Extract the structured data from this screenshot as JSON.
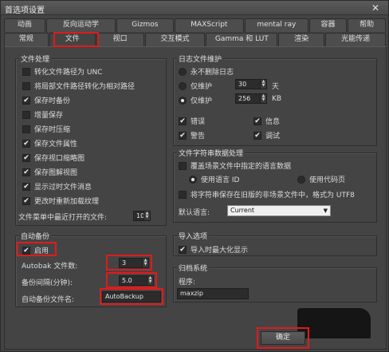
{
  "window": {
    "title": "首选项设置",
    "close_label": "✕"
  },
  "tabs_row1": [
    {
      "label": "动画"
    },
    {
      "label": "反向运动学"
    },
    {
      "label": "Gizmos"
    },
    {
      "label": "MAXScript"
    },
    {
      "label": "mental ray"
    },
    {
      "label": "容器"
    },
    {
      "label": "帮助"
    }
  ],
  "tabs_row2": [
    {
      "label": "常规"
    },
    {
      "label": "文件"
    },
    {
      "label": "视口"
    },
    {
      "label": "交互模式"
    },
    {
      "label": "Gamma 和 LUT"
    },
    {
      "label": "渲染"
    },
    {
      "label": "光能传递"
    }
  ],
  "file_handling": {
    "title": "文件处理",
    "options": [
      {
        "label": "转化文件路径为 UNC",
        "checked": false
      },
      {
        "label": "将局部文件路径转化为相对路径",
        "checked": false
      },
      {
        "label": "保存时备份",
        "checked": true
      },
      {
        "label": "增量保存",
        "checked": false
      },
      {
        "label": "保存时压缩",
        "checked": false
      },
      {
        "label": "保存文件属性",
        "checked": true
      },
      {
        "label": "保存视口缩略图",
        "checked": true
      },
      {
        "label": "保存图解视图",
        "checked": true
      },
      {
        "label": "显示过时文件消息",
        "checked": true
      },
      {
        "label": "更改时重新加载纹理",
        "checked": true
      }
    ],
    "recent_label": "文件菜单中最近打开的文件:",
    "recent_value": "10"
  },
  "log": {
    "title": "日志文件维护",
    "never_delete": "永不删除日志",
    "keep_days_label": "仅维护",
    "keep_days_value": "30",
    "days_unit": "天",
    "keep_kb_label": "仅维护",
    "keep_kb_value": "256",
    "kb_unit": "KB",
    "error": "错误",
    "info": "信息",
    "warning": "警告",
    "debug": "调试"
  },
  "charset": {
    "title": "文件字符串数据处理",
    "override": "覆盖场景文件中指定的语言数据",
    "use_language_id": "使用语言 ID",
    "use_codepage": "使用代码页",
    "save_utf8": "将字符串保存在旧版的非场景文件中，格式为 UTF8",
    "default_lang_label": "默认语言:",
    "default_lang_value": "Current"
  },
  "autobackup": {
    "title": "自动备份",
    "enable": "启用",
    "count_label": "Autobak 文件数:",
    "count_value": "3",
    "interval_label": "备份间隔(分钟):",
    "interval_value": "5.0",
    "name_label": "自动备份文件名:",
    "name_value": "AutoBackup"
  },
  "import": {
    "title": "导入选项",
    "maximize": "导入时最大化显示"
  },
  "archive": {
    "title": "归档系统",
    "program_label": "程序:",
    "program_value": "maxzip"
  },
  "buttons": {
    "ok": "确定"
  },
  "highlight_color": "#e01b1b"
}
